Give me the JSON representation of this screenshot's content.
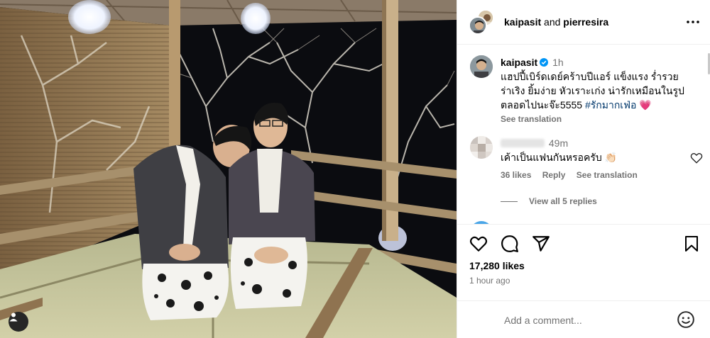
{
  "post": {
    "author": "kaipasit",
    "collaborator": "pierresira",
    "and_word": "and",
    "caption_time": "1h",
    "caption_lines": [
      "แฮปปี้เบิร์ดเดย์คร้าบปีแอร์ แข็งแรง ร่ำรวย",
      "ร่าเริง ยิ้มง่าย หัวเราะเก่ง น่ารักเหมือนในรูป",
      "ตลอดไปนะจ๊ะ5555"
    ],
    "hashtag": "#รักมากเฟ่อ",
    "caption_emoji": "💗",
    "see_translation": "See translation",
    "likes": "17,280 likes",
    "posted_ago": "1 hour ago"
  },
  "comment": {
    "time": "49m",
    "text": "เค้าเป็นแฟนกันหรอครับ",
    "emoji": "👏🏻",
    "likes": "36 likes",
    "reply": "Reply",
    "see_translation": "See translation",
    "view_replies": "View all 5 replies"
  },
  "composer": {
    "placeholder": "Add a comment..."
  },
  "icons": {
    "verified": "verified-badge-icon",
    "more": "more-options-icon",
    "like": "heart-icon",
    "comment": "comment-icon",
    "share": "share-icon",
    "save": "bookmark-icon",
    "emoji": "emoji-icon",
    "tags": "user-tag-icon"
  },
  "colors": {
    "accent_blue": "#0095f6",
    "hashtag": "#00376b",
    "muted": "#737373",
    "heart_emoji": "#ff3b6b"
  }
}
